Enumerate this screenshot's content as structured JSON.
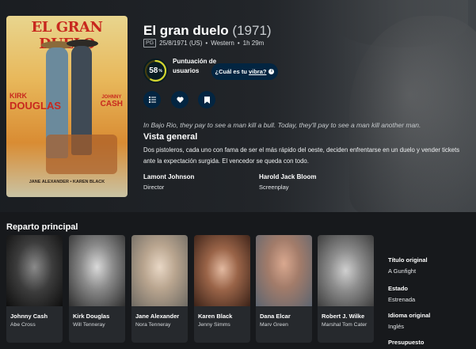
{
  "poster": {
    "title": "EL GRAN DUELO",
    "star_left_first": "KIRK",
    "star_left_last": "DOUGLAS",
    "star_right_first": "JOHNNY",
    "star_right_last": "CASH",
    "credits": "JANE ALEXANDER  •  KAREN BLACK"
  },
  "movie": {
    "title": "El gran duelo",
    "year": "(1971)",
    "certification": "PG",
    "release": "25/8/1971 (US)",
    "genre": "Western",
    "runtime": "1h 29m"
  },
  "score": {
    "value": "58",
    "percent_sign": "%",
    "percent": 58,
    "label": "Puntuación de usuarios",
    "ring_color": "#d2d531"
  },
  "vibe": {
    "prefix": "¿Cuál es tu",
    "link": "vibra?",
    "info": "i"
  },
  "actions": [
    "list-icon",
    "heart-icon",
    "bookmark-icon"
  ],
  "tagline": "In Bajo Rio, they pay to see a man kill a bull. Today, they'll pay to see a man kill another man.",
  "overview": {
    "heading": "Vista general",
    "text": "Dos pistoleros, cada uno con fama de ser el más rápido del oeste, deciden enfrentarse en un duelo y vender tickets ante la expectación surgida. El vencedor se queda con todo."
  },
  "crew": [
    {
      "name": "Lamont Johnson",
      "role": "Director"
    },
    {
      "name": "Harold Jack Bloom",
      "role": "Screenplay"
    }
  ],
  "cast": {
    "heading": "Reparto principal",
    "members": [
      {
        "name": "Johnny Cash",
        "character": "Abe Cross"
      },
      {
        "name": "Kirk Douglas",
        "character": "Will Tenneray"
      },
      {
        "name": "Jane Alexander",
        "character": "Nora Tenneray"
      },
      {
        "name": "Karen Black",
        "character": "Jenny Simms"
      },
      {
        "name": "Dana Elcar",
        "character": "Marv Green"
      },
      {
        "name": "Robert J. Wilke",
        "character": "Marshal Tom Cater"
      }
    ]
  },
  "facts": [
    {
      "label": "Título original",
      "value": "A Gunfight"
    },
    {
      "label": "Estado",
      "value": "Estrenada"
    },
    {
      "label": "Idioma original",
      "value": "Inglés"
    },
    {
      "label": "Presupuesto",
      "value": ""
    }
  ]
}
